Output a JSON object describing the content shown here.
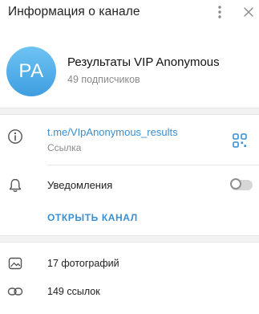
{
  "header": {
    "title": "Информация о канале",
    "more_icon": "more-vertical-icon",
    "close_icon": "close-icon"
  },
  "profile": {
    "avatar_initials": "PA",
    "avatar_color": "#4ea9e6",
    "name": "Результаты VIP Anonymous",
    "subscribers": "49 подписчиков"
  },
  "info": {
    "link": "t.me/VIpAnonymous_results",
    "link_caption": "Ссылка",
    "notifications_label": "Уведомления",
    "notifications_enabled": false,
    "open_channel": "ОТКРЫТЬ КАНАЛ"
  },
  "media": {
    "photos": "17 фотографий",
    "links": "149 ссылок"
  },
  "colors": {
    "accent": "#3a8fd0",
    "muted": "#8a8a8a"
  }
}
